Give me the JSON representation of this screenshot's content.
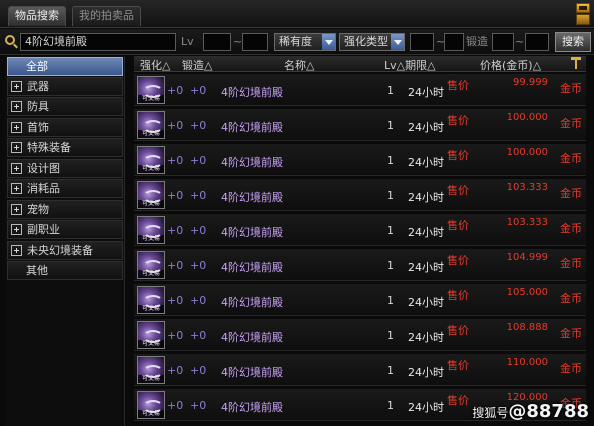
{
  "tabs": [
    {
      "label": "物品搜索",
      "active": true
    },
    {
      "label": "我的拍卖品",
      "active": false
    }
  ],
  "search": {
    "keyword": "4阶幻境前殿",
    "lv_label": "Lv",
    "lv_sep": "~",
    "rarity_select": "稀有度",
    "upgrade_type_select": "强化类型",
    "upgrade_sep": "~",
    "forge_label": "锻造",
    "forge_sep": "~",
    "button_label": "搜索"
  },
  "categories": [
    {
      "label": "全部",
      "expandable": false,
      "selected": true
    },
    {
      "label": "武器",
      "expandable": true,
      "selected": false
    },
    {
      "label": "防具",
      "expandable": true,
      "selected": false
    },
    {
      "label": "首饰",
      "expandable": true,
      "selected": false
    },
    {
      "label": "特殊装备",
      "expandable": true,
      "selected": false
    },
    {
      "label": "设计图",
      "expandable": true,
      "selected": false
    },
    {
      "label": "消耗品",
      "expandable": true,
      "selected": false
    },
    {
      "label": "宠物",
      "expandable": true,
      "selected": false
    },
    {
      "label": "副职业",
      "expandable": true,
      "selected": false
    },
    {
      "label": "未央幻境装备",
      "expandable": true,
      "selected": false
    },
    {
      "label": "其他",
      "expandable": false,
      "selected": false
    }
  ],
  "columns": {
    "upgrade": "强化△",
    "forge": "锻造△",
    "name": "名称△",
    "lv_period": "Lv△期限△",
    "price": "价格(金币)△"
  },
  "item_icon_label": "可交易",
  "rows": [
    {
      "upgrade": "+0",
      "forge": "+0",
      "name": "4阶幻境前殿",
      "lv": "1",
      "duration": "24小时",
      "sale": "售价",
      "price": "99.999",
      "currency": "金币"
    },
    {
      "upgrade": "+0",
      "forge": "+0",
      "name": "4阶幻境前殿",
      "lv": "1",
      "duration": "24小时",
      "sale": "售价",
      "price": "100.000",
      "currency": "金币"
    },
    {
      "upgrade": "+0",
      "forge": "+0",
      "name": "4阶幻境前殿",
      "lv": "1",
      "duration": "24小时",
      "sale": "售价",
      "price": "100.000",
      "currency": "金币"
    },
    {
      "upgrade": "+0",
      "forge": "+0",
      "name": "4阶幻境前殿",
      "lv": "1",
      "duration": "24小时",
      "sale": "售价",
      "price": "103.333",
      "currency": "金币"
    },
    {
      "upgrade": "+0",
      "forge": "+0",
      "name": "4阶幻境前殿",
      "lv": "1",
      "duration": "24小时",
      "sale": "售价",
      "price": "103.333",
      "currency": "金币"
    },
    {
      "upgrade": "+0",
      "forge": "+0",
      "name": "4阶幻境前殿",
      "lv": "1",
      "duration": "24小时",
      "sale": "售价",
      "price": "104.999",
      "currency": "金币"
    },
    {
      "upgrade": "+0",
      "forge": "+0",
      "name": "4阶幻境前殿",
      "lv": "1",
      "duration": "24小时",
      "sale": "售价",
      "price": "105.000",
      "currency": "金币"
    },
    {
      "upgrade": "+0",
      "forge": "+0",
      "name": "4阶幻境前殿",
      "lv": "1",
      "duration": "24小时",
      "sale": "售价",
      "price": "108.888",
      "currency": "金币"
    },
    {
      "upgrade": "+0",
      "forge": "+0",
      "name": "4阶幻境前殿",
      "lv": "1",
      "duration": "24小时",
      "sale": "售价",
      "price": "110.000",
      "currency": "金币"
    },
    {
      "upgrade": "+0",
      "forge": "+0",
      "name": "4阶幻境前殿",
      "lv": "1",
      "duration": "24小时",
      "sale": "售价",
      "price": "120.000",
      "currency": "金币"
    }
  ],
  "watermark": {
    "prefix": "搜狐号",
    "id": "@88788"
  },
  "colors": {
    "price_red": "#e53a2b",
    "item_name_purple": "#c8a2f5",
    "selected_blue": "#3a568c"
  }
}
